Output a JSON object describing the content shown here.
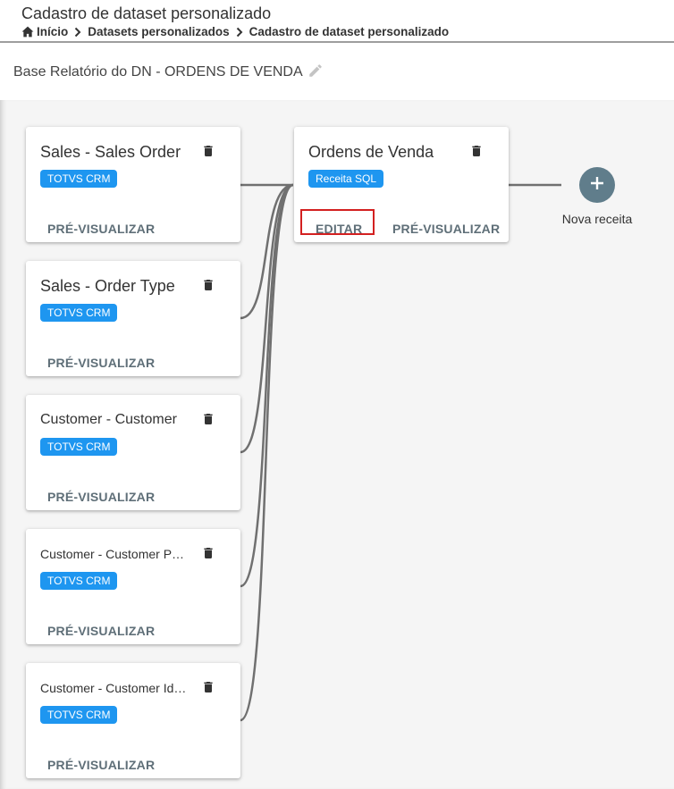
{
  "header": {
    "title": "Cadastro de dataset personalizado",
    "breadcrumb": [
      {
        "label": "Início"
      },
      {
        "label": "Datasets personalizados"
      },
      {
        "label": "Cadastro de dataset personalizado"
      }
    ]
  },
  "dataset": {
    "name": "Base Relatório do DN - ORDENS DE VENDA"
  },
  "sources": [
    {
      "title": "Sales - Sales Order",
      "badge": "TOTVS CRM",
      "preview_label": "PRÉ-VISUALIZAR"
    },
    {
      "title": "Sales - Order Type",
      "badge": "TOTVS CRM",
      "preview_label": "PRÉ-VISUALIZAR"
    },
    {
      "title": "Customer - Customer",
      "badge": "TOTVS CRM",
      "preview_label": "PRÉ-VISUALIZAR"
    },
    {
      "title": "Customer - Customer Per…",
      "badge": "TOTVS CRM",
      "preview_label": "PRÉ-VISUALIZAR"
    },
    {
      "title": "Customer - Customer Ide…",
      "badge": "TOTVS CRM",
      "preview_label": "PRÉ-VISUALIZAR"
    }
  ],
  "recipe": {
    "title": "Ordens de Venda",
    "badge": "Receita SQL",
    "edit_label": "EDITAR",
    "preview_label": "PRÉ-VISUALIZAR"
  },
  "new_recipe": {
    "label": "Nova receita"
  },
  "colors": {
    "badge": "#1e96f0",
    "add_button": "#607d8b",
    "highlight": "#d32020",
    "connector": "#707070"
  },
  "icons": {
    "home": "home-icon",
    "chevron": "chevron-right-icon",
    "edit": "pencil-icon",
    "delete": "trash-icon",
    "add": "plus-icon"
  }
}
